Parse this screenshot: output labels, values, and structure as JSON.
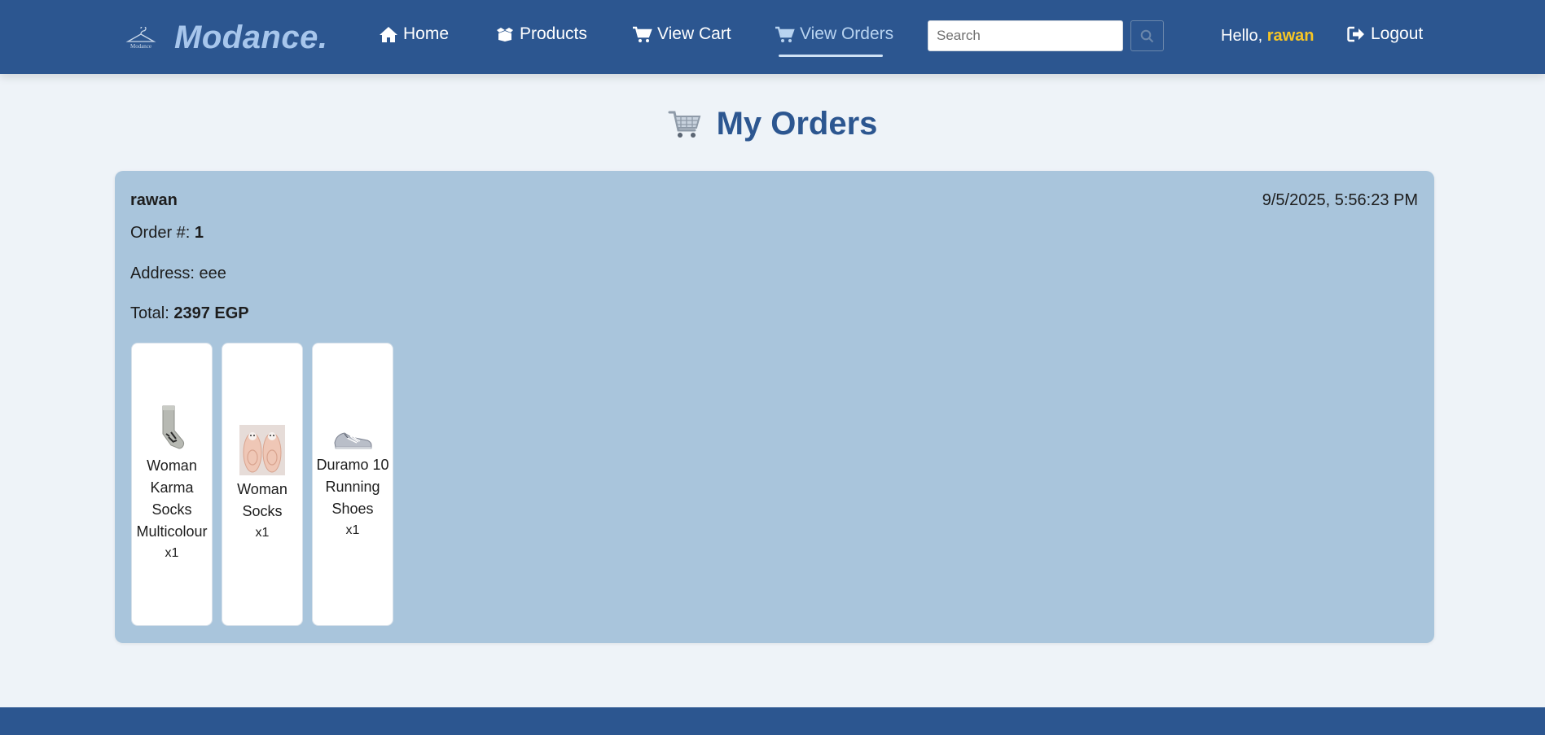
{
  "brand": {
    "logo_text": "Modance",
    "name": "Modance."
  },
  "nav": {
    "home": "Home",
    "products": "Products",
    "view_cart": "View Cart",
    "view_orders": "View Orders",
    "active": "view_orders"
  },
  "search": {
    "placeholder": "Search",
    "value": ""
  },
  "user": {
    "greeting": "Hello, ",
    "name": "rawan"
  },
  "logout": "Logout",
  "page_title": "My Orders",
  "order": {
    "user": "rawan",
    "date": "9/5/2025, 5:56:23 PM",
    "order_label": "Order #: ",
    "order_number": "1",
    "address_label": "Address: ",
    "address": "eee",
    "total_label": "Total: ",
    "total": "2397 EGP",
    "items": [
      {
        "name": "Woman Karma Socks Multicolour",
        "qty": "x1",
        "icon": "sock-icon"
      },
      {
        "name": "Woman Socks",
        "qty": "x1",
        "icon": "slipper-socks-icon"
      },
      {
        "name": "Duramo 10 Running Shoes",
        "qty": "x1",
        "icon": "running-shoe-icon"
      }
    ]
  },
  "colors": {
    "navbar": "#2c5690",
    "brand": "#a7c6ec",
    "accent_username": "#f7c625",
    "card": "#a9c5dc",
    "page_bg": "#eef3f8"
  }
}
